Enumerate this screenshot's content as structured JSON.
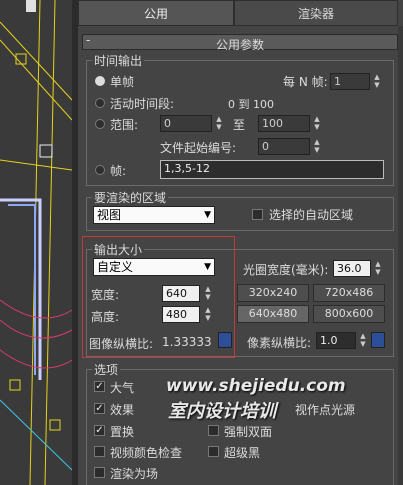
{
  "tabs": [
    {
      "label": "公用",
      "active": true
    },
    {
      "label": "渲染器",
      "active": false
    }
  ],
  "rollout": {
    "toggle": "-",
    "title": "公用参数"
  },
  "time_output": {
    "title": "时间输出",
    "single": "单帧",
    "every_n_label": "每 N 帧:",
    "every_n_value": "1",
    "active_segment": "活动时间段:",
    "active_range": "0 到 100",
    "range": "范围:",
    "range_from": "0",
    "range_to_label": "至",
    "range_to": "100",
    "file_start_label": "文件起始编号:",
    "file_start_value": "0",
    "frames": "帧:",
    "frames_value": "1,3,5-12",
    "selected": "single"
  },
  "render_area": {
    "title": "要渲染的区域",
    "mode": "视图",
    "auto_region": "选择的自动区域",
    "auto_region_checked": false
  },
  "output_size": {
    "title": "输出大小",
    "preset": "自定义",
    "aperture_label": "光圈宽度(毫米):",
    "aperture_value": "36.0",
    "width_label": "宽度:",
    "width_value": "640",
    "height_label": "高度:",
    "height_value": "480",
    "presets": [
      "320x240",
      "720x486",
      "640x480",
      "800x600"
    ],
    "active_preset": "640x480",
    "image_aspect_label": "图像纵横比:",
    "image_aspect_value": "1.33333",
    "pixel_aspect_label": "像素纵横比:",
    "pixel_aspect_value": "1.0"
  },
  "options": {
    "title": "选项",
    "items": [
      {
        "label": "大气",
        "checked": true
      },
      {
        "label": "效果",
        "checked": true
      },
      {
        "label": "置换",
        "checked": true
      },
      {
        "label": "视频颜色检查",
        "checked": false
      },
      {
        "label": "渲染为场",
        "checked": false
      },
      {
        "label": "视作点光源",
        "checked": false
      },
      {
        "label": "强制双面",
        "checked": false
      },
      {
        "label": "超级黑",
        "checked": false
      }
    ]
  },
  "watermark": {
    "url": "www.shejiedu.com",
    "cn": "室内设计培训"
  },
  "colors": {
    "highlight_box": "#c23a3a",
    "panel_bg": "#444444"
  }
}
